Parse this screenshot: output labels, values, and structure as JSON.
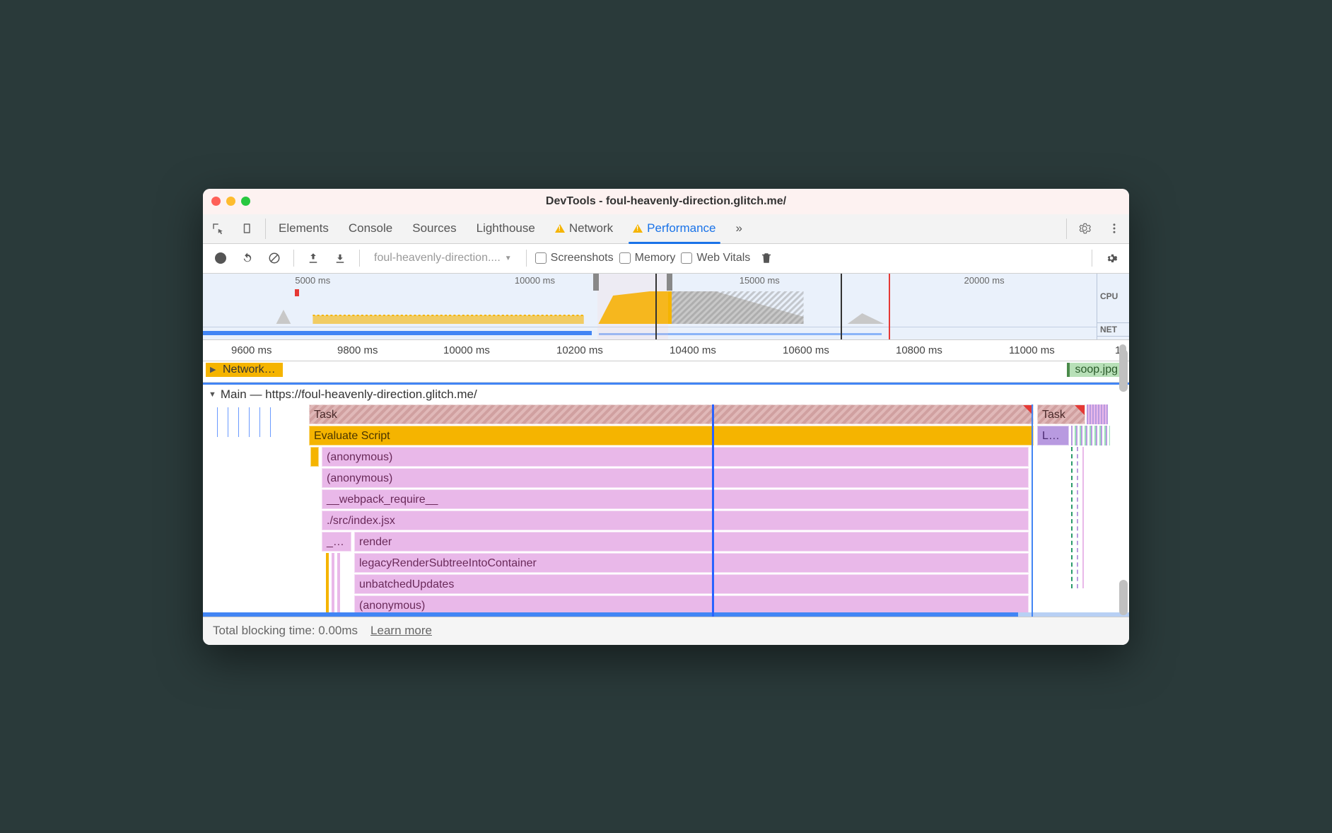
{
  "window": {
    "title": "DevTools - foul-heavenly-direction.glitch.me/"
  },
  "tabs": {
    "elements": "Elements",
    "console": "Console",
    "sources": "Sources",
    "lighthouse": "Lighthouse",
    "network": "Network",
    "performance": "Performance",
    "more": "»"
  },
  "toolbar": {
    "target": "foul-heavenly-direction....",
    "target_caret": "▼",
    "screenshots": "Screenshots",
    "memory": "Memory",
    "webvitals": "Web Vitals"
  },
  "overview": {
    "ticks": [
      "5000 ms",
      "10000 ms",
      "15000 ms",
      "20000 ms"
    ],
    "cpu_label": "CPU",
    "net_label": "NET"
  },
  "ruler": {
    "ticks": [
      "9600 ms",
      "9800 ms",
      "10000 ms",
      "10200 ms",
      "10400 ms",
      "10600 ms",
      "10800 ms",
      "11000 ms",
      "1"
    ]
  },
  "network_row": {
    "label": "Network…",
    "file": "soop.jpg"
  },
  "main": {
    "title": "Main — https://foul-heavenly-direction.glitch.me/",
    "task": "Task",
    "task2": "Task",
    "eval": "Evaluate Script",
    "purple": "L…",
    "anon1": "(anonymous)",
    "anon2": "(anonymous)",
    "wpreq": "__webpack_require__",
    "idx": "./src/index.jsx",
    "trunc": "_…",
    "render": "render",
    "legacy": "legacyRenderSubtreeIntoContainer",
    "unbatch": "unbatchedUpdates",
    "anon3": "(anonymous)"
  },
  "footer": {
    "tbt": "Total blocking time: 0.00ms",
    "learn": "Learn more"
  }
}
